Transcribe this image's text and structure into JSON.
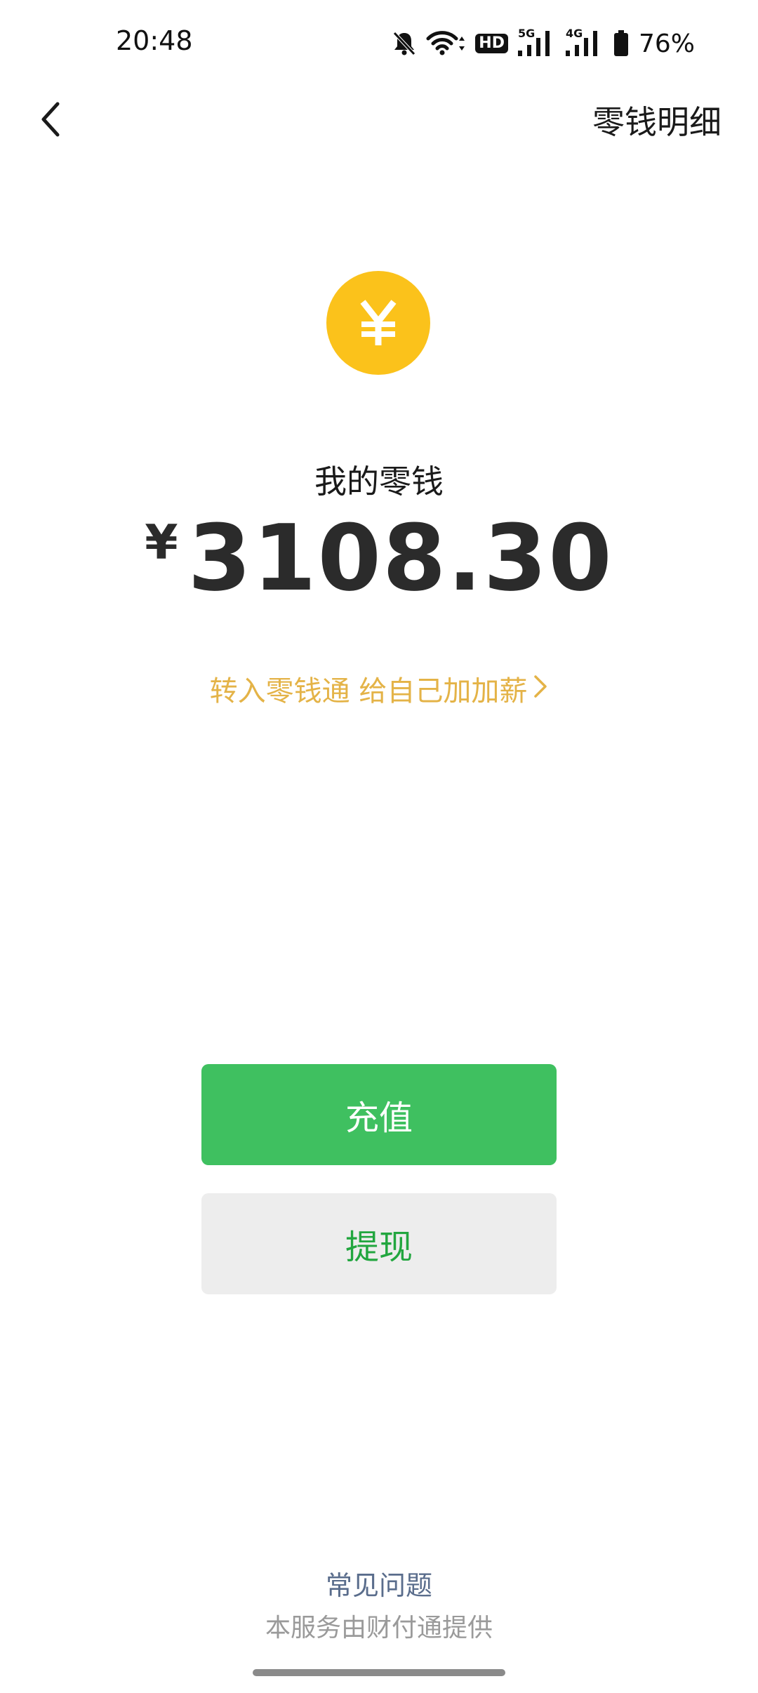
{
  "status_bar": {
    "time": "20:48",
    "hd_label": "HD",
    "net_primary": "5G",
    "net_secondary": "4G",
    "battery": "76%",
    "icons": [
      "mute-bell-icon",
      "wifi-icon",
      "hd-icon",
      "signal-5g-icon",
      "signal-4g-icon",
      "battery-icon"
    ]
  },
  "nav": {
    "back_icon": "chevron-left-icon",
    "detail_label": "零钱明细"
  },
  "balance": {
    "icon": "yuan-coin-icon",
    "coin_color": "#fbc21b",
    "label": "我的零钱",
    "currency_symbol": "¥",
    "amount": "3108.30"
  },
  "promo": {
    "text": "转入零钱通 给自己加加薪",
    "color": "#e4b347"
  },
  "actions": {
    "recharge_label": "充值",
    "recharge_color": "#3fc060",
    "withdraw_label": "提现",
    "withdraw_color": "#22a63f"
  },
  "footer": {
    "faq_label": "常见问题",
    "provider_note": "本服务由财付通提供"
  }
}
